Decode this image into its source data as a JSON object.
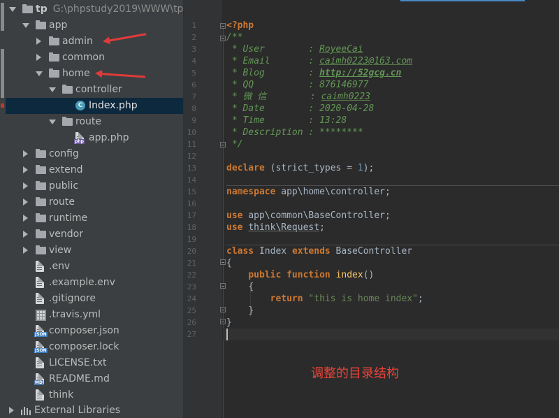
{
  "project": {
    "root_name": "tp",
    "root_path": "G:\\phpstudy2019\\WWW\\tp",
    "tree": [
      {
        "label": "app",
        "type": "folder",
        "depth": 1,
        "expanded": true
      },
      {
        "label": "admin",
        "type": "folder",
        "depth": 2,
        "expanded": false,
        "annotated": true
      },
      {
        "label": "common",
        "type": "folder",
        "depth": 2,
        "expanded": false
      },
      {
        "label": "home",
        "type": "folder",
        "depth": 2,
        "expanded": true,
        "annotated": true
      },
      {
        "label": "controller",
        "type": "folder",
        "depth": 3,
        "expanded": true
      },
      {
        "label": "Index.php",
        "type": "class-file",
        "depth": 4,
        "selected": true
      },
      {
        "label": "route",
        "type": "folder",
        "depth": 3,
        "expanded": true
      },
      {
        "label": "app.php",
        "type": "php-file",
        "depth": 4
      },
      {
        "label": "config",
        "type": "folder",
        "depth": 1,
        "expanded": false
      },
      {
        "label": "extend",
        "type": "folder",
        "depth": 1,
        "expanded": false
      },
      {
        "label": "public",
        "type": "folder",
        "depth": 1,
        "expanded": false
      },
      {
        "label": "route",
        "type": "folder",
        "depth": 1,
        "expanded": false
      },
      {
        "label": "runtime",
        "type": "folder",
        "depth": 1,
        "expanded": false
      },
      {
        "label": "vendor",
        "type": "folder",
        "depth": 1,
        "expanded": false
      },
      {
        "label": "view",
        "type": "folder",
        "depth": 1,
        "expanded": false
      },
      {
        "label": ".env",
        "type": "text-file",
        "depth": 1
      },
      {
        "label": ".example.env",
        "type": "text-file",
        "depth": 1
      },
      {
        "label": ".gitignore",
        "type": "text-file",
        "depth": 1
      },
      {
        "label": ".travis.yml",
        "type": "table-file",
        "depth": 1
      },
      {
        "label": "composer.json",
        "type": "json-file",
        "depth": 1
      },
      {
        "label": "composer.lock",
        "type": "json-file",
        "depth": 1
      },
      {
        "label": "LICENSE.txt",
        "type": "text-file",
        "depth": 1
      },
      {
        "label": "README.md",
        "type": "md-file",
        "depth": 1
      },
      {
        "label": "think",
        "type": "text-file",
        "depth": 1
      }
    ],
    "external_libraries": "External Libraries",
    "badges": {
      "json": "JSON",
      "php": "php",
      "md": "MD",
      "class": "C"
    }
  },
  "editor": {
    "line_numbers": [
      "1",
      "2",
      "3",
      "4",
      "5",
      "6",
      "7",
      "8",
      "9",
      "10",
      "11",
      "12",
      "13",
      "14",
      "15",
      "16",
      "17",
      "18",
      "19",
      "20",
      "21",
      "22",
      "23",
      "24",
      "25",
      "26",
      "27"
    ],
    "code": {
      "l1": "<?php",
      "l2": "/**",
      "l3_key": " * User        : ",
      "l3_val": "RoyeeCai",
      "l4_key": " * Email       : ",
      "l4_val": "caimh0223@163.com",
      "l5_key": " * Blog        : ",
      "l5_val": "http://52gcg.cn",
      "l6_key": " * QQ          : ",
      "l6_val": "876146977",
      "l7_key": " * 微 信        : ",
      "l7_val": "caimh0223",
      "l8_key": " * Date        : ",
      "l8_val": "2020-04-28",
      "l9_key": " * Time        : ",
      "l9_val": "13:28",
      "l10": " * Description : ********",
      "l11": " */",
      "l13_kw": "declare",
      "l13_a": " (strict_types = ",
      "l13_num": "1",
      "l13_b": ");",
      "l15_kw": "namespace",
      "l15_rest": " app\\home\\controller;",
      "l17_kw": "use",
      "l17_rest": " app\\common\\BaseController;",
      "l18_kw": "use",
      "l18_a": " ",
      "l18_dim": "think\\Request",
      "l18_b": ";",
      "l20_kw1": "class",
      "l20_a": " Index ",
      "l20_kw2": "extends",
      "l20_b": " BaseController",
      "l21": "{",
      "l22_kw1": "public",
      "l22_kw2": "function",
      "l22_fn": "index",
      "l22_rest": "()",
      "l23": "{",
      "l24_kw": "return",
      "l24_str": "\"this is home index\"",
      "l24_end": ";",
      "l25": "}",
      "l26": "}"
    },
    "caption": "调整的目录结构"
  }
}
